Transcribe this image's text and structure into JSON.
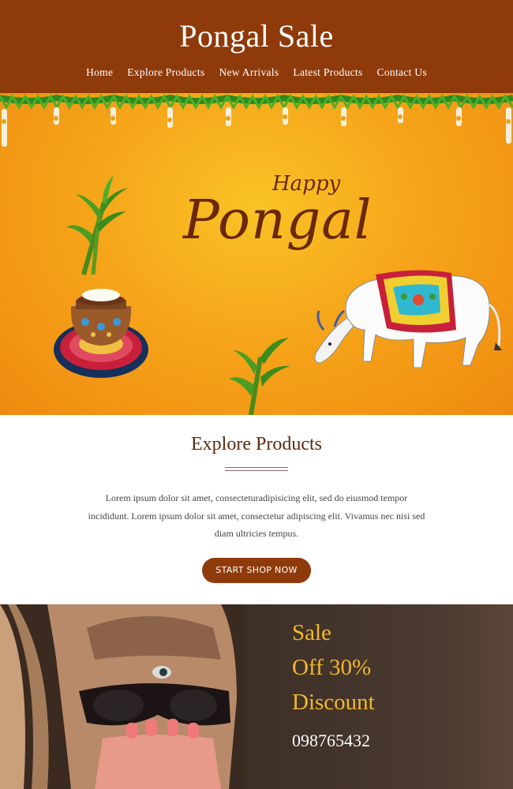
{
  "header": {
    "title": "Pongal Sale",
    "nav": [
      "Home",
      "Explore Products",
      "New Arrivals",
      "Latest Products",
      "Contact Us"
    ]
  },
  "banner": {
    "happy_text": "Happy",
    "pongal_text": "Pongal"
  },
  "explore": {
    "heading": "Explore Products",
    "body": "Lorem ipsum dolor sit amet, consecteturadipisicing elit, sed do eiusmod tempor incididunt. Lorem ipsum dolor sit amet, consectetur adipiscing elit. Vivamus nec nisi sed diam ultricies tempus.",
    "button_label": "START SHOP NOW"
  },
  "sale": {
    "line1": "Sale",
    "line2": "Off 30%",
    "line3": "Discount",
    "phone": "098765432"
  },
  "colors": {
    "header_bg": "#8f3a0a",
    "banner_orange": "#f6a51a",
    "sale_gold": "#f2b829"
  }
}
